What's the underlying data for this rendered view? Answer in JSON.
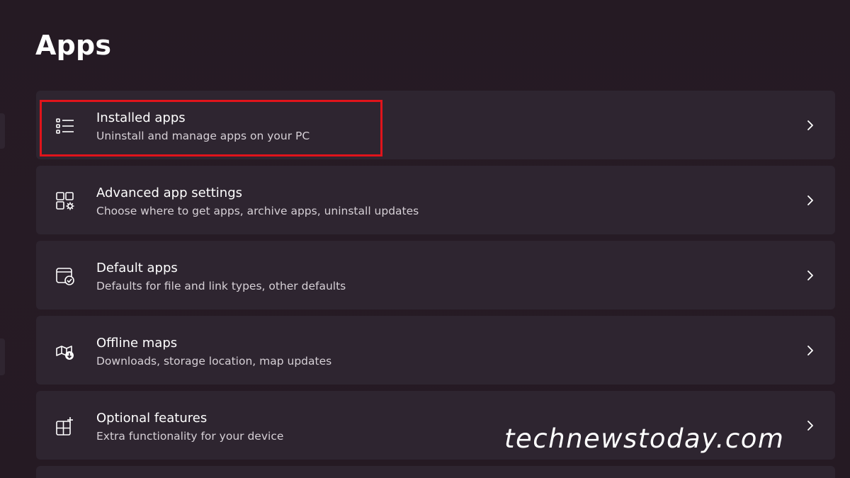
{
  "page": {
    "title": "Apps"
  },
  "items": [
    {
      "title": "Installed apps",
      "subtitle": "Uninstall and manage apps on your PC",
      "icon": "list-icon"
    },
    {
      "title": "Advanced app settings",
      "subtitle": "Choose where to get apps, archive apps, uninstall updates",
      "icon": "app-settings-icon"
    },
    {
      "title": "Default apps",
      "subtitle": "Defaults for file and link types, other defaults",
      "icon": "default-apps-icon"
    },
    {
      "title": "Offline maps",
      "subtitle": "Downloads, storage location, map updates",
      "icon": "map-download-icon"
    },
    {
      "title": "Optional features",
      "subtitle": "Extra functionality for your device",
      "icon": "add-feature-icon"
    }
  ],
  "watermark": "technewstoday.com",
  "colors": {
    "background": "#251a23",
    "card": "#2e2530",
    "highlight": "#e0141b"
  }
}
